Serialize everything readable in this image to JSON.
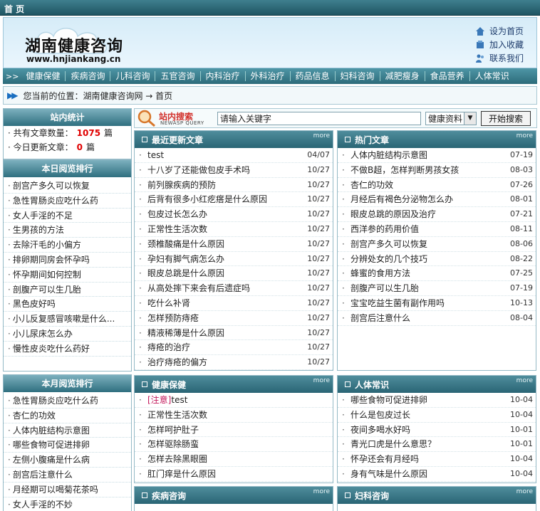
{
  "topbar": {
    "home": "首 页"
  },
  "header": {
    "logo_cn": "湖南健康咨询",
    "logo_url": "www.hnjiankang.cn",
    "links": [
      "设为首页",
      "加入收藏",
      "联系我们"
    ]
  },
  "nav": {
    "arrows": ">>",
    "items": [
      "健康保健",
      "疾病咨询",
      "儿科咨询",
      "五官咨询",
      "内科治疗",
      "外科治疗",
      "药品信息",
      "妇科咨询",
      "减肥瘦身",
      "食品营养",
      "人体常识"
    ]
  },
  "location": {
    "text": "您当前的位置：湖南健康咨询网 → 首页"
  },
  "sidebar": {
    "stats": {
      "title": "站内统计",
      "total_label": "· 共有文章数量：",
      "total_value": "1075",
      "unit": "篇",
      "today_label": "· 今日更新文章：",
      "today_value": "0"
    },
    "day_rank": {
      "title": "本日阅览排行",
      "items": [
        "剖宫产多久可以恢复",
        "急性胃肠炎应吃什么药",
        "女人手淫的不足",
        "生男孩的方法",
        "去除汗毛的小偏方",
        "排卵期同房会怀孕吗",
        "怀孕期间如何控制",
        "剖腹产可以生几胎",
        "黑色皮好吗",
        "小儿反复感冒咳嗽是什么...",
        "小儿尿床怎么办",
        "慢性皮炎吃什么药好"
      ]
    },
    "month_rank": {
      "title": "本月阅览排行",
      "items": [
        "急性胃肠炎应吃什么药",
        "杏仁的功效",
        "人体内脏结构示意图",
        "哪些食物可促进排卵",
        "左侧小腹痛是什么病",
        "剖宫后注意什么",
        "月经期可以喝菊花茶吗",
        "女人手淫的不妙"
      ]
    }
  },
  "search": {
    "title": "站内搜索",
    "subtitle": "NEWASP QUERY",
    "input_value": "请输入关键字",
    "select_value": "健康资料",
    "button": "开始搜索"
  },
  "panels": {
    "latest": {
      "title": "最近更新文章",
      "more": "more",
      "rows": [
        {
          "title": "test",
          "date": "04/07"
        },
        {
          "title": "十八岁了还能做包皮手术吗",
          "date": "10/27"
        },
        {
          "title": "前列腺疾病的预防",
          "date": "10/27"
        },
        {
          "title": "后背有很多小红疙瘩是什么原因",
          "date": "10/27"
        },
        {
          "title": "包皮过长怎么办",
          "date": "10/27"
        },
        {
          "title": "正常性生活次数",
          "date": "10/27"
        },
        {
          "title": "颈椎酸痛是什么原因",
          "date": "10/27"
        },
        {
          "title": "孕妇有脚气病怎么办",
          "date": "10/27"
        },
        {
          "title": "眼皮总跳是什么原因",
          "date": "10/27"
        },
        {
          "title": "从高处摔下来会有后遗症吗",
          "date": "10/27"
        },
        {
          "title": "吃什么补肾",
          "date": "10/27"
        },
        {
          "title": "怎样预防痔疮",
          "date": "10/27"
        },
        {
          "title": "精液稀薄是什么原因",
          "date": "10/27"
        },
        {
          "title": "痔疮的治疗",
          "date": "10/27"
        },
        {
          "title": "治疗痔疮的偏方",
          "date": "10/27"
        }
      ]
    },
    "hot": {
      "title": "热门文章",
      "more": "more",
      "rows": [
        {
          "title": "人体内脏结构示意图",
          "date": "07-19"
        },
        {
          "title": "不做B超，怎样判断男孩女孩",
          "date": "08-03"
        },
        {
          "title": "杏仁的功效",
          "date": "07-26"
        },
        {
          "title": "月经后有褐色分泌物怎么办",
          "date": "08-01"
        },
        {
          "title": "眼皮总跳的原因及治疗",
          "date": "07-21"
        },
        {
          "title": "西洋参的药用价值",
          "date": "08-11"
        },
        {
          "title": "剖宫产多久可以恢复",
          "date": "08-06"
        },
        {
          "title": "分辨处女的几个技巧",
          "date": "08-22"
        },
        {
          "title": "蜂蜜的食用方法",
          "date": "07-25"
        },
        {
          "title": "剖腹产可以生几胎",
          "date": "07-19"
        },
        {
          "title": "宝宝吃益生菌有副作用吗",
          "date": "10-13"
        },
        {
          "title": "剖宫后注意什么",
          "date": "08-04"
        }
      ]
    },
    "health": {
      "title": "健康保健",
      "more": "more",
      "rows": [
        {
          "tag": "[注意]",
          "title": "test",
          "date": ""
        },
        {
          "title": "正常性生活次数",
          "date": ""
        },
        {
          "title": "怎样呵护肚子",
          "date": ""
        },
        {
          "title": "怎样驱除肠蛮",
          "date": ""
        },
        {
          "title": "怎样去除黑眼圈",
          "date": ""
        },
        {
          "title": "肛门痒是什么原因",
          "date": ""
        }
      ]
    },
    "body": {
      "title": "人体常识",
      "more": "more",
      "rows": [
        {
          "title": "哪些食物可促进排卵",
          "date": "10-04"
        },
        {
          "title": "什么是包皮过长",
          "date": "10-04"
        },
        {
          "title": "夜间多喝水好吗",
          "date": "10-01"
        },
        {
          "title": "青光口虎是什么意思？",
          "date": "10-01"
        },
        {
          "title": "怀孕还会有月经吗",
          "date": "10-04"
        },
        {
          "title": "身有气味是什么原因",
          "date": "10-04"
        }
      ]
    },
    "disease": {
      "title": "疾病咨询",
      "more": "more"
    },
    "gyn": {
      "title": "妇科咨询",
      "more": "more"
    }
  }
}
